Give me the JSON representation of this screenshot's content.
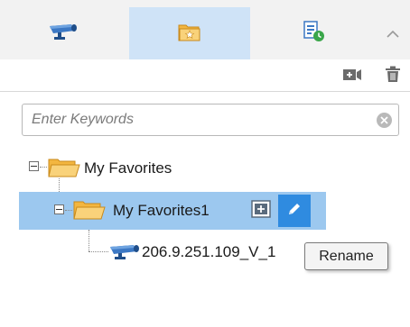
{
  "tabs": [
    {
      "icon": "camera-icon",
      "active": false
    },
    {
      "icon": "favorites-folder-icon",
      "active": true
    },
    {
      "icon": "schedule-list-icon",
      "active": false
    }
  ],
  "collapse_icon": "chevron-up-icon",
  "toolbar": {
    "add_icon": "add-view-icon",
    "delete_icon": "trash-icon"
  },
  "search": {
    "placeholder": "Enter Keywords",
    "value": ""
  },
  "tree": {
    "root": {
      "label": "My Favorites",
      "expanded": true
    },
    "child": {
      "label": "My Favorites1",
      "expanded": true,
      "selected": true
    },
    "leaf": {
      "label": "206.9.251.109_V_1"
    }
  },
  "tooltip": {
    "text": "Rename"
  },
  "colors": {
    "selected_row": "#9cc8ef",
    "active_tab": "#cfe3f7",
    "edit_button": "#2f8be0",
    "folder": "#f7c55a",
    "schedule_green": "#3aa64a"
  }
}
